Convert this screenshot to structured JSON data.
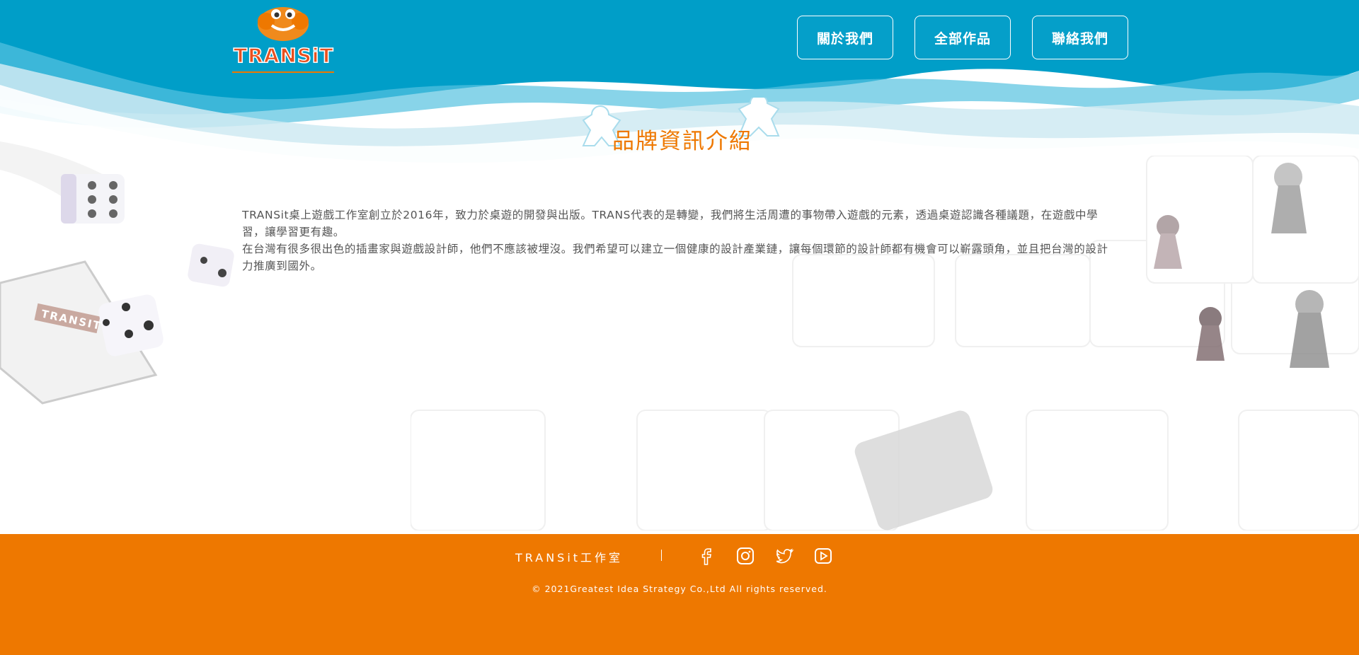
{
  "header": {
    "logo_text": "TRANSiT",
    "nav": [
      {
        "label": "關於我們"
      },
      {
        "label": "全部作品"
      },
      {
        "label": "聯絡我們"
      }
    ]
  },
  "main": {
    "title": "品牌資訊介紹",
    "paragraphs": [
      "TRANSit桌上遊戲工作室創立於2016年，致力於桌遊的開發與出版。TRANS代表的是轉變，我們將生活周遭的事物帶入遊戲的元素，透過桌遊認識各種議題，在遊戲中學習，讓學習更有趣。",
      "在台灣有很多很出色的插畫家與遊戲設計師，他們不應該被埋沒。我們希望可以建立一個健康的設計產業鏈，讓每個環節的設計師都有機會可以嶄露頭角，並且把台灣的設計力推廣到國外。"
    ],
    "board_label": "TRANSIT"
  },
  "footer": {
    "brand": "TRANSit工作室",
    "social": [
      {
        "icon": "facebook-icon"
      },
      {
        "icon": "instagram-icon"
      },
      {
        "icon": "twitter-icon"
      },
      {
        "icon": "youtube-icon"
      }
    ],
    "copyright": "© 2021Greatest Idea Strategy Co.,Ltd All rights reserved."
  },
  "colors": {
    "header_blue": "#009ec8",
    "accent_orange": "#ee7800",
    "light_blue": "#cfeaf2"
  }
}
